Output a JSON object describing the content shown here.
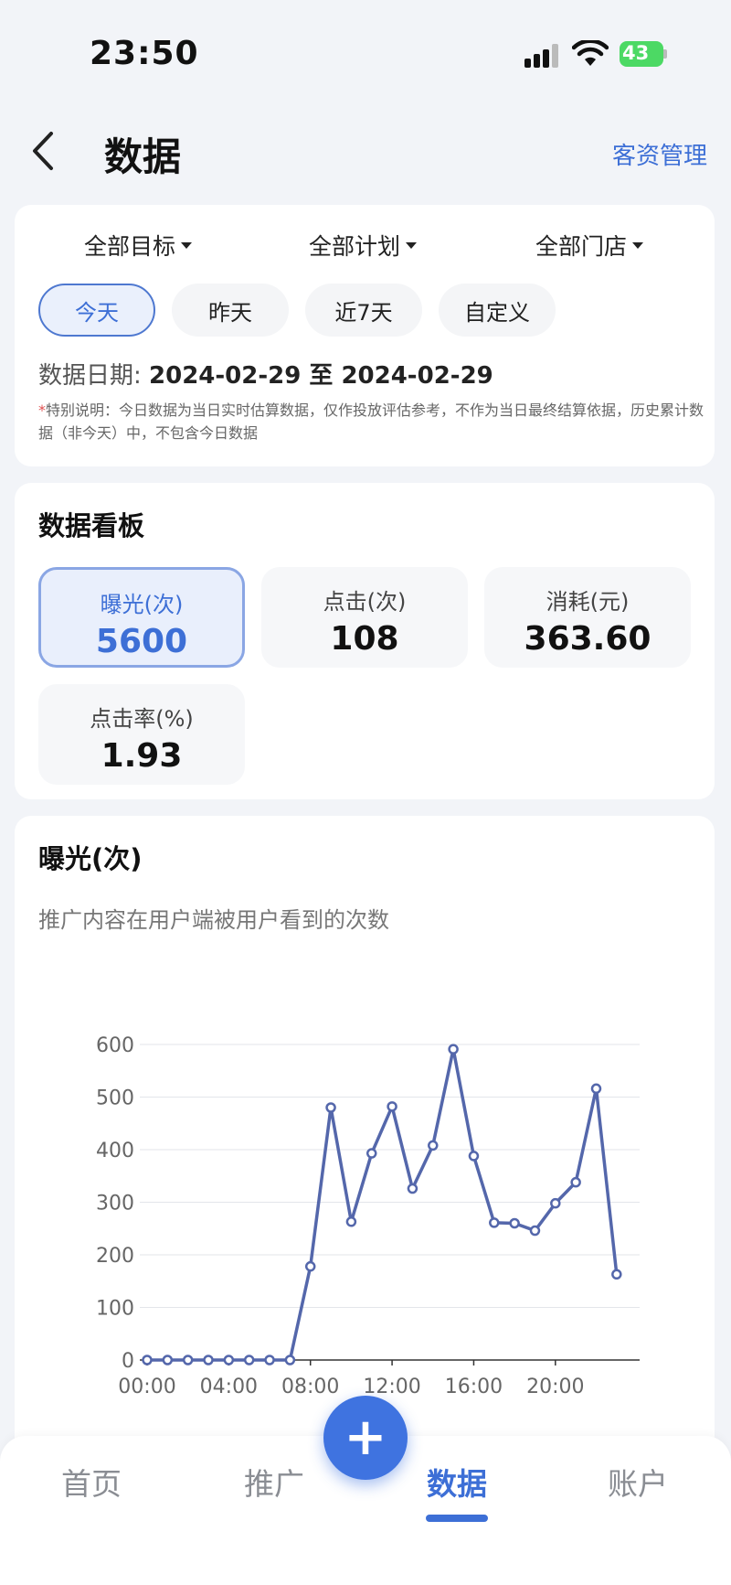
{
  "status": {
    "time": "23:50",
    "battery": "43"
  },
  "header": {
    "back_icon": "chevron-left-icon",
    "title": "数据",
    "right_link": "客资管理"
  },
  "filters": [
    {
      "label": "全部目标"
    },
    {
      "label": "全部计划"
    },
    {
      "label": "全部门店"
    }
  ],
  "date_tabs": [
    {
      "label": "今天",
      "active": true
    },
    {
      "label": "昨天"
    },
    {
      "label": "近7天"
    },
    {
      "label": "自定义"
    }
  ],
  "date_range": {
    "prefix": "数据日期: ",
    "value": "2024-02-29 至 2024-02-29"
  },
  "note": {
    "star": "*",
    "text": "特别说明：今日数据为当日实时估算数据，仅作投放评估参考，不作为当日最终结算依据，历史累计数据（非今天）中，不包含今日数据"
  },
  "board": {
    "title": "数据看板",
    "metrics": [
      {
        "label": "曝光(次)",
        "value": "5600",
        "active": true
      },
      {
        "label": "点击(次)",
        "value": "108"
      },
      {
        "label": "消耗(元)",
        "value": "363.60"
      },
      {
        "label": "点击率(%)",
        "value": "1.93"
      }
    ]
  },
  "chart_section": {
    "title": "曝光(次)",
    "subtitle": "推广内容在用户端被用户看到的次数"
  },
  "chart_data": {
    "type": "line",
    "title": "",
    "xlabel": "",
    "ylabel": "",
    "x": [
      "00:00",
      "01:00",
      "02:00",
      "03:00",
      "04:00",
      "05:00",
      "06:00",
      "07:00",
      "08:00",
      "09:00",
      "10:00",
      "11:00",
      "12:00",
      "13:00",
      "14:00",
      "15:00",
      "16:00",
      "17:00",
      "18:00",
      "19:00",
      "20:00",
      "21:00",
      "22:00",
      "23:00"
    ],
    "x_tick_labels": [
      "00:00",
      "04:00",
      "08:00",
      "12:00",
      "16:00",
      "20:00"
    ],
    "y_ticks": [
      0,
      100,
      200,
      300,
      400,
      500,
      600
    ],
    "ylim": [
      0,
      600
    ],
    "series": [
      {
        "color": "#5467ab",
        "values": [
          0,
          0,
          0,
          0,
          0,
          0,
          0,
          0,
          178,
          480,
          263,
          393,
          482,
          326,
          408,
          591,
          388,
          261,
          260,
          246,
          298,
          338,
          516,
          163
        ]
      }
    ],
    "grid": true
  },
  "fab": {
    "icon": "plus-icon",
    "symbol": "+"
  },
  "bottom_nav": [
    {
      "label": "首页"
    },
    {
      "label": "推广"
    },
    {
      "label": "数据",
      "active": true
    },
    {
      "label": "账户"
    }
  ]
}
